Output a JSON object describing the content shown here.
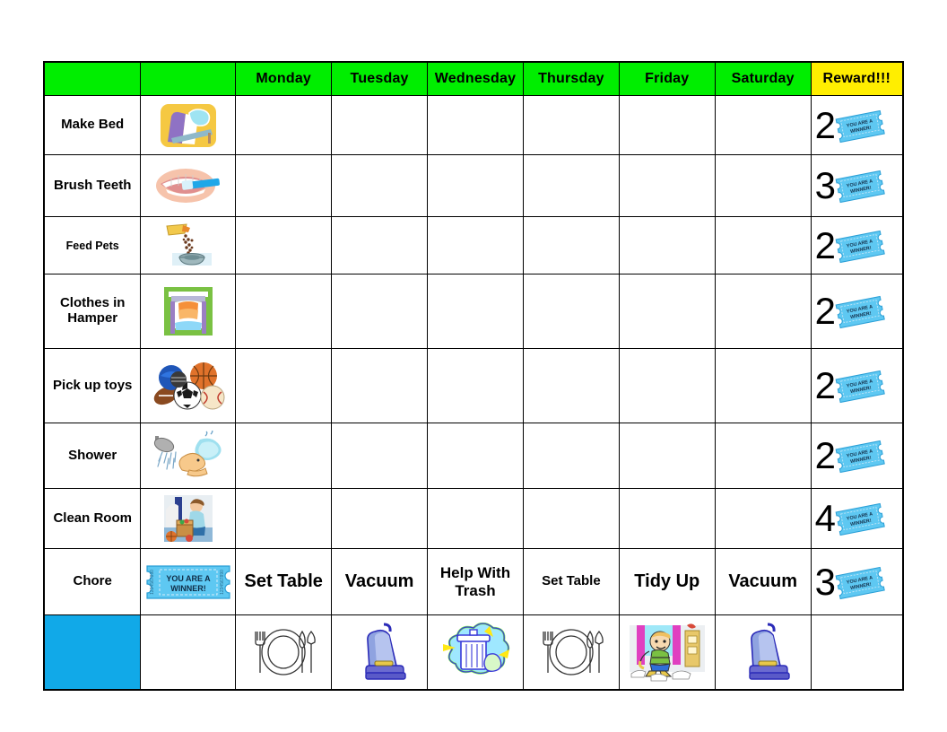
{
  "table": {
    "headers": [
      "",
      "",
      "Monday",
      "Tuesday",
      "Wednesday",
      "Thursday",
      "Friday",
      "Saturday",
      "Reward!!!"
    ],
    "colors": {
      "header_green": "#00ee00",
      "header_yellow": "#ffee00",
      "label_blue": "#11a9e8",
      "cell_white": "#ffffff",
      "border_black": "#000000",
      "ticket_blue": "#5ec8f2"
    },
    "rows": [
      {
        "label": "Make Bed",
        "icon": "bed-icon",
        "reward": "2",
        "reward_ticket": "winner-ticket-icon"
      },
      {
        "label": "Brush Teeth",
        "icon": "toothbrush-mouth-icon",
        "reward": "3",
        "reward_ticket": "winner-ticket-icon"
      },
      {
        "label": "Feed Pets",
        "icon": "pet-food-bowl-icon",
        "reward": "2",
        "reward_ticket": "winner-ticket-icon"
      },
      {
        "label": "Clothes in Hamper",
        "icon": "laundry-hamper-icon",
        "reward": "2",
        "reward_ticket": "winner-ticket-icon"
      },
      {
        "label": "Pick up toys",
        "icon": "sports-balls-icon",
        "reward": "2",
        "reward_ticket": "winner-ticket-icon"
      },
      {
        "label": "Shower",
        "icon": "shower-icon",
        "reward": "2",
        "reward_ticket": "winner-ticket-icon"
      },
      {
        "label": "Clean Room",
        "icon": "child-cleaning-room-icon",
        "reward": "4",
        "reward_ticket": "winner-ticket-icon"
      }
    ],
    "chore_row": {
      "label": "Chore",
      "icon": "winner-ticket-icon",
      "days": [
        "Set Table",
        "Vacuum",
        "Help With Trash",
        "Set Table",
        "Tidy Up",
        "Vacuum"
      ],
      "reward": "3",
      "reward_ticket": "winner-ticket-icon"
    },
    "chore_icon_row": {
      "label": "",
      "icon": "",
      "day_icons": [
        "place-setting-icon",
        "vacuum-cleaner-icon",
        "trash-can-icon",
        "place-setting-icon",
        "kid-tidying-up-icon",
        "vacuum-cleaner-icon"
      ],
      "reward": ""
    }
  },
  "ticket": {
    "line1": "YOU ARE A",
    "line2": "WINNER!",
    "serial": "1234567890"
  }
}
